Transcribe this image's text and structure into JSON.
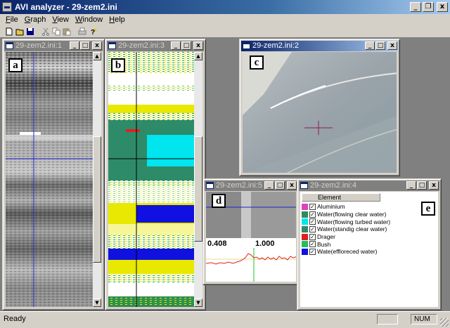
{
  "app": {
    "title": "AVI analyzer - 29-zem2.ini",
    "controls": {
      "minimize": "_",
      "restore": "❐",
      "close": "x"
    }
  },
  "menu": [
    "File",
    "Graph",
    "View",
    "Window",
    "Help"
  ],
  "menu_mnemonics": [
    "F",
    "G",
    "V",
    "W",
    "H"
  ],
  "toolbar": [
    "new-icon",
    "open-icon",
    "save-icon",
    "cut-icon",
    "copy-icon",
    "paste-icon",
    "print-icon",
    "help-icon"
  ],
  "windows": {
    "w1": {
      "title": "29-zem2.ini:1",
      "label": "a"
    },
    "w3": {
      "title": "29-zem2.ini:3",
      "label": "b"
    },
    "w2": {
      "title": "29-zem2.ini:2",
      "label": "c"
    },
    "w5": {
      "title": "29-zem2.ini:5",
      "label": "d",
      "value_left": "0.408",
      "value_right": "1.000"
    },
    "w4": {
      "title": "29-zem2.ini:4",
      "label": "e",
      "legend_header": "Element",
      "legend": [
        {
          "color": "#e040c0",
          "name": "Aluminium"
        },
        {
          "color": "#2e8b57",
          "name": "Water(flowing clear water)"
        },
        {
          "color": "#00e5ee",
          "name": "Water(flowing turbed water)"
        },
        {
          "color": "#2e8b6a",
          "name": "Water(standig clear water)"
        },
        {
          "color": "#e02020",
          "name": "Drager"
        },
        {
          "color": "#20c060",
          "name": "Bush"
        },
        {
          "color": "#1010e0",
          "name": "Wate(effloreced water)"
        }
      ]
    }
  },
  "status": {
    "text": "Ready",
    "num": "NUM"
  }
}
